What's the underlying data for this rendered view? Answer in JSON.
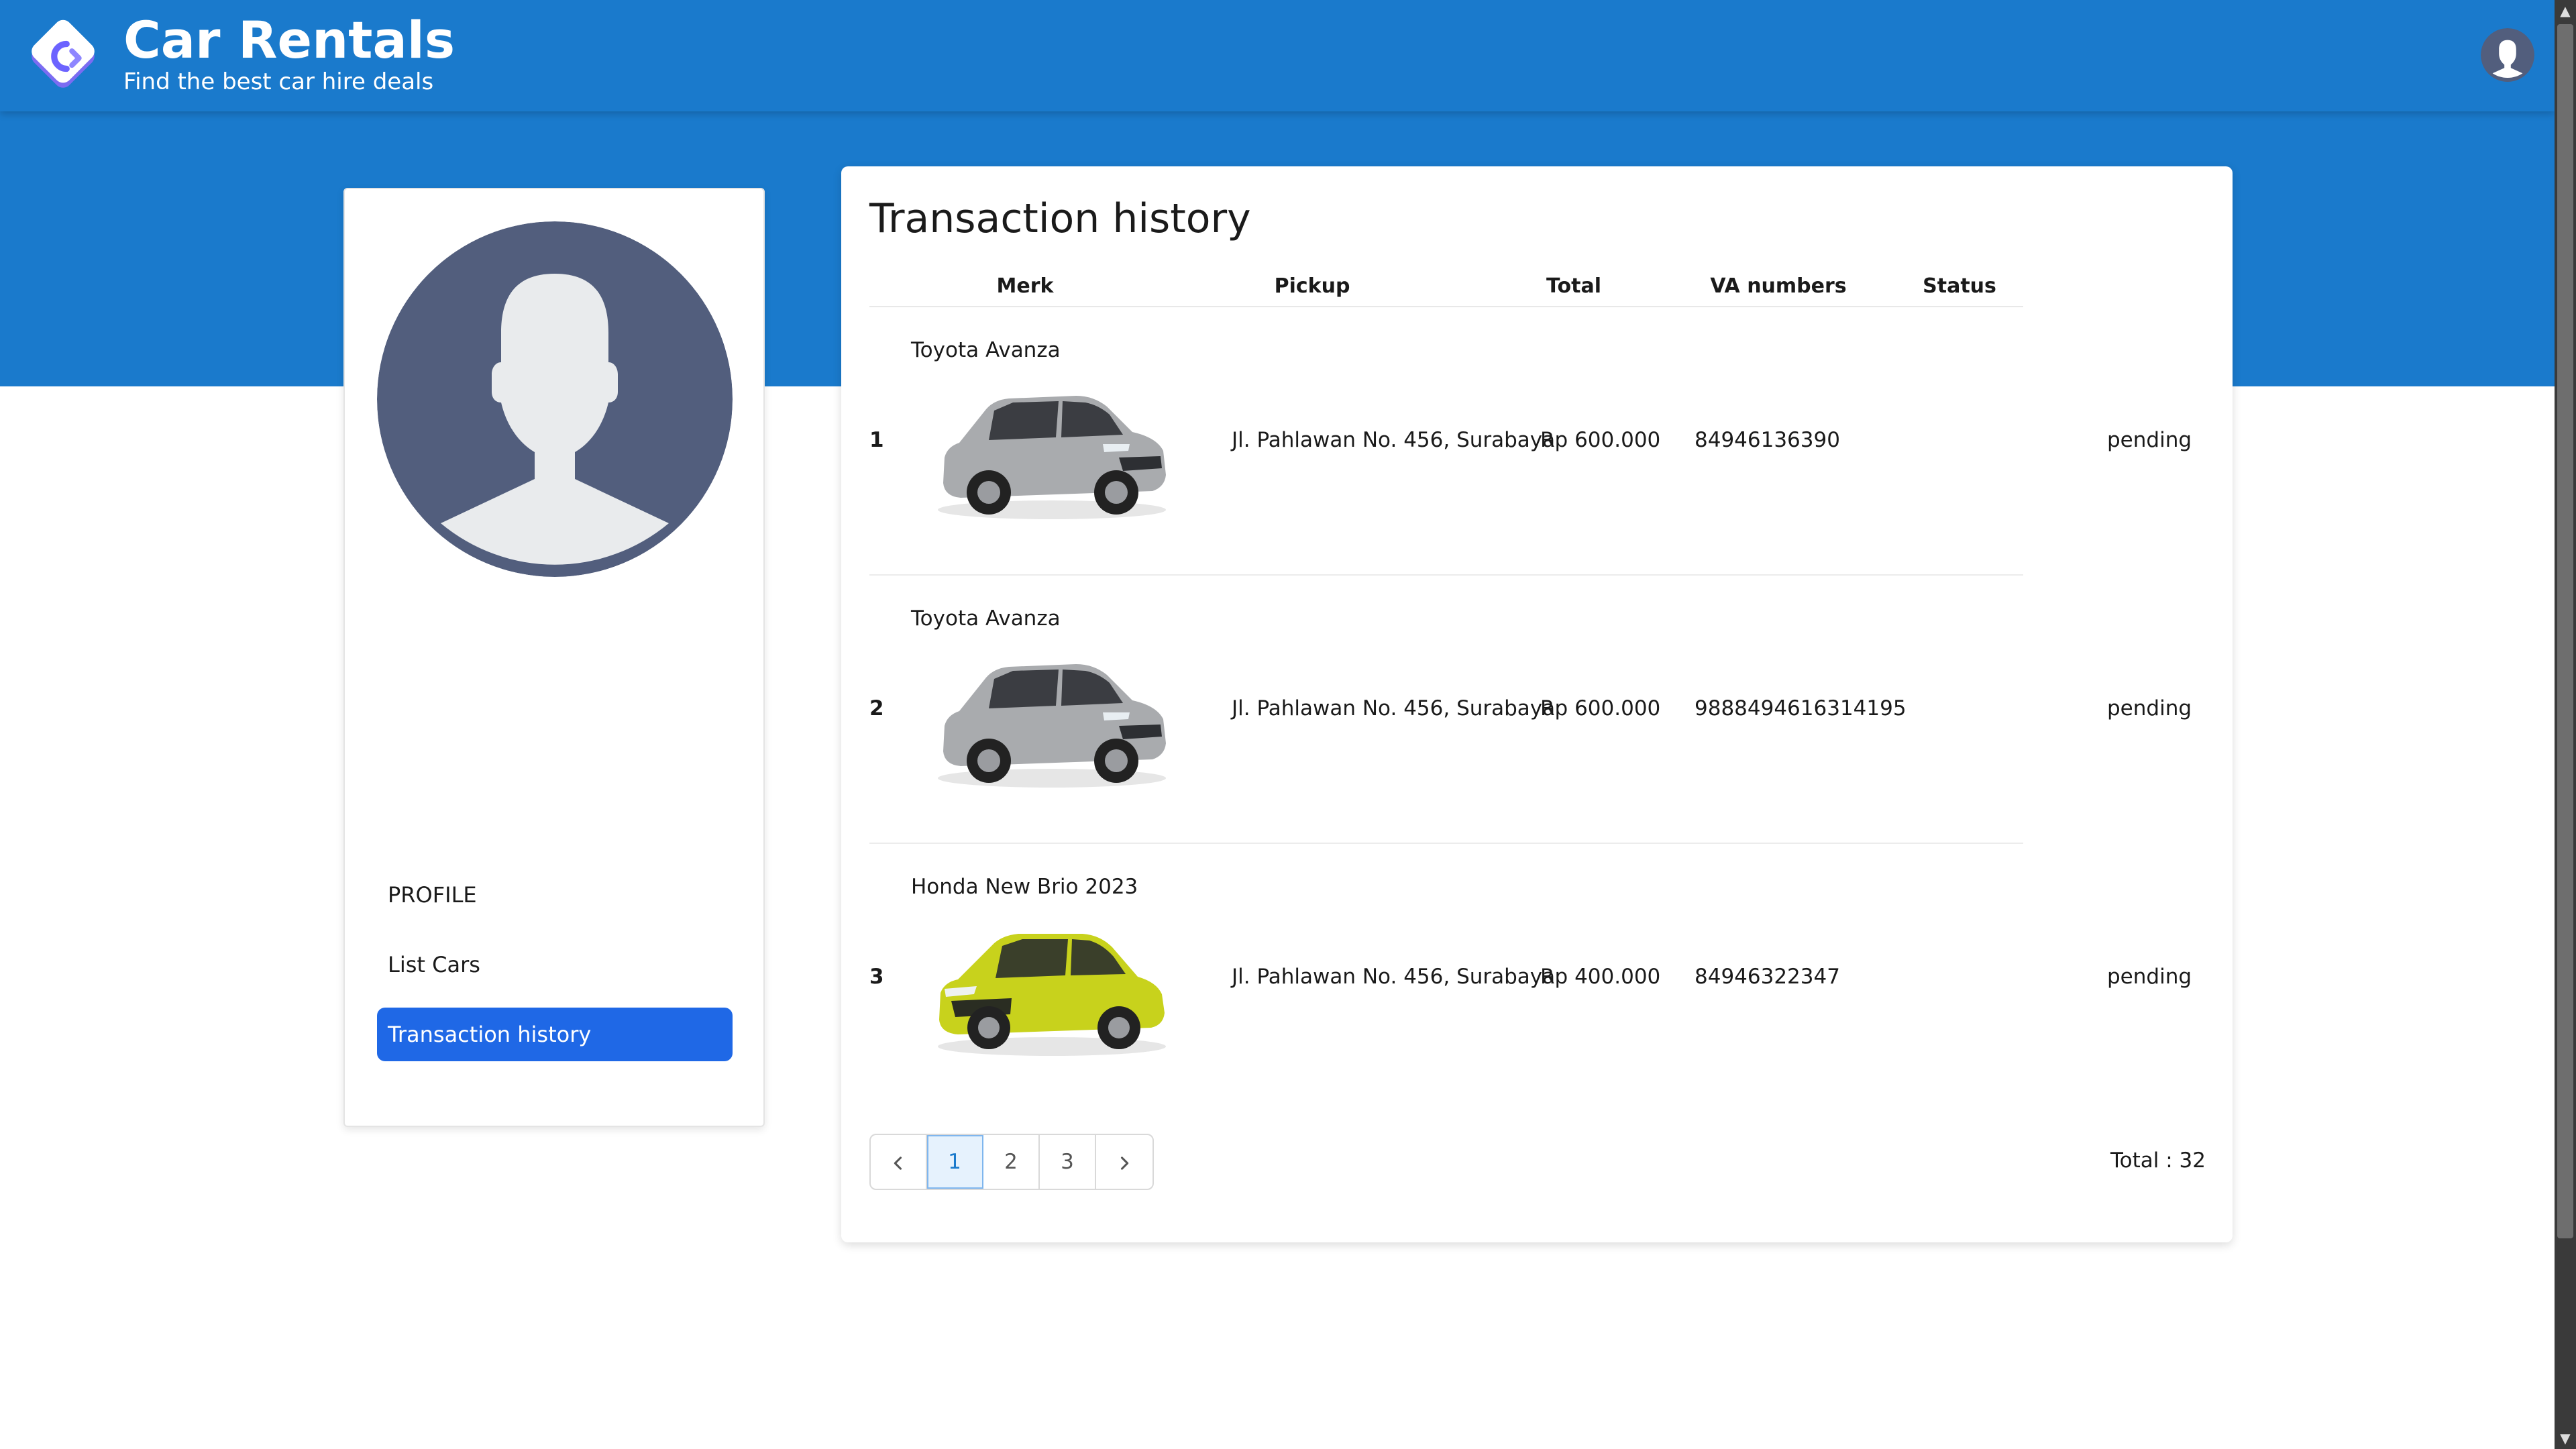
{
  "header": {
    "title": "Car Rentals",
    "subtitle": "Find the best car hire deals"
  },
  "sidebar": {
    "items": [
      {
        "label": "PROFILE"
      },
      {
        "label": "List Cars"
      },
      {
        "label": "Transaction history",
        "active": true
      }
    ]
  },
  "main": {
    "title": "Transaction history",
    "columns": [
      "Merk",
      "Pickup",
      "Total",
      "VA numbers",
      "Status"
    ],
    "rows": [
      {
        "no": "1",
        "merk": "Toyota Avanza",
        "car_color": "silver",
        "pickup": "Jl. Pahlawan No. 456, Surabaya",
        "total": "Rp 600.000",
        "va": "84946136390",
        "status": "pending"
      },
      {
        "no": "2",
        "merk": "Toyota Avanza",
        "car_color": "silver",
        "pickup": "Jl. Pahlawan No. 456, Surabaya",
        "total": "Rp 600.000",
        "va": "9888494616314195",
        "status": "pending"
      },
      {
        "no": "3",
        "merk": "Honda New Brio 2023",
        "car_color": "yellow-green",
        "pickup": "Jl. Pahlawan No. 456, Surabaya",
        "total": "Rp 400.000",
        "va": "84946322347",
        "status": "pending"
      }
    ],
    "pagination": {
      "pages": [
        "1",
        "2",
        "3"
      ],
      "current": "1",
      "prev_icon": "chevron-left-icon",
      "next_icon": "chevron-right-icon"
    },
    "total_label": "Total : 32"
  },
  "colors": {
    "brand_blue": "#1a7acc",
    "active_menu": "#1f68e6",
    "avatar_bg": "#525e7d",
    "silhouette": "#e9ebed"
  }
}
